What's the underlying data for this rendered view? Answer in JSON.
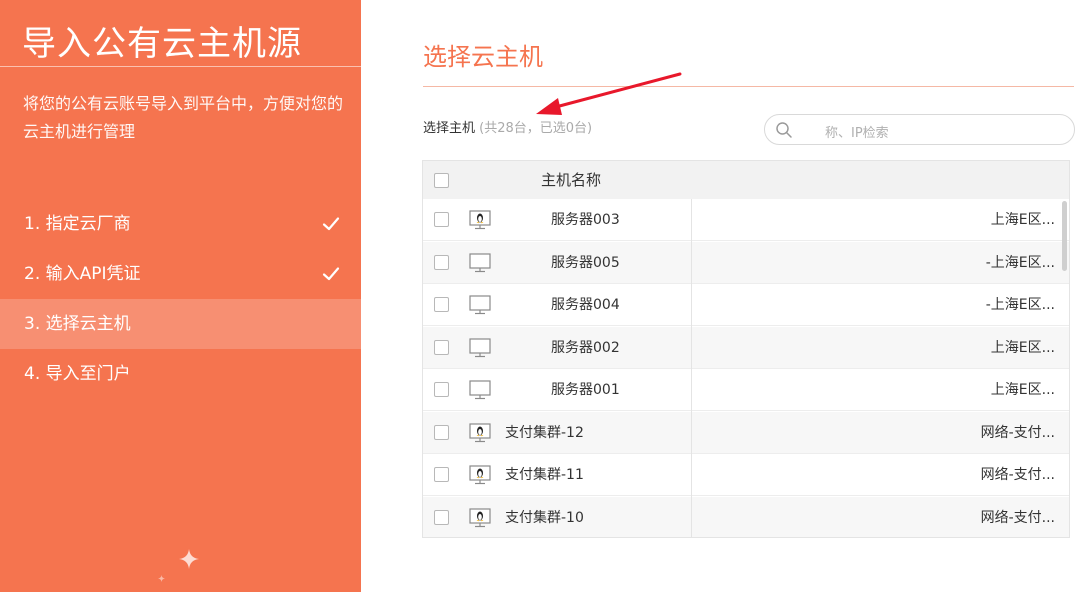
{
  "sidebar": {
    "title": "导入公有云主机源",
    "description": "将您的公有云账号导入到平台中，方便对您的云主机进行管理",
    "steps": [
      {
        "label": "1. 指定云厂商",
        "done": true
      },
      {
        "label": "2. 输入API凭证",
        "done": true
      },
      {
        "label": "3. 选择云主机",
        "active": true
      },
      {
        "label": "4. 导入至门户"
      }
    ]
  },
  "main": {
    "title": "选择云主机",
    "select_label": "选择主机",
    "select_count": "(共28台，已选0台)",
    "search": {
      "placeholder": "",
      "hint_suffix": "称、IP检索"
    }
  },
  "table": {
    "header": {
      "name": "主机名称"
    },
    "rows": [
      {
        "name": "服务器003",
        "region": "上海E区...",
        "icon": "linux-monitor-icon"
      },
      {
        "name": "服务器005",
        "region": "-上海E区...",
        "icon": "monitor-icon"
      },
      {
        "name": "服务器004",
        "region": "-上海E区...",
        "icon": "monitor-icon"
      },
      {
        "name": "服务器002",
        "region": "上海E区...",
        "icon": "monitor-icon"
      },
      {
        "name": "服务器001",
        "region": "上海E区...",
        "icon": "monitor-icon"
      },
      {
        "name": "支付集群-12",
        "region": "网络-支付...",
        "icon": "linux-monitor-icon"
      },
      {
        "name": "支付集群-11",
        "region": "网络-支付...",
        "icon": "linux-monitor-icon"
      },
      {
        "name": "支付集群-10",
        "region": "网络-支付...",
        "icon": "linux-monitor-icon"
      }
    ]
  },
  "colors": {
    "accent": "#f5744f",
    "annotation": "#e8182b"
  }
}
